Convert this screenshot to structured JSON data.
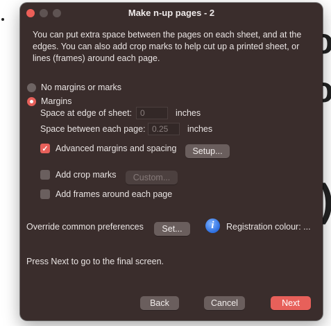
{
  "window": {
    "title": "Make n-up pages - 2"
  },
  "intro": "You can put extra space between the pages on each sheet, and at the edges. You can also add crop marks to help cut up a printed sheet, or lines (frames) around each page.",
  "options": {
    "no_margins_label": "No margins or marks",
    "margins_label": "Margins",
    "selected": "Margins"
  },
  "edge": {
    "label": "Space at edge of sheet:",
    "value": "0",
    "unit": "inches"
  },
  "between": {
    "label": "Space between each page:",
    "value": "0.25",
    "unit": "inches"
  },
  "advanced": {
    "label": "Advanced margins and spacing",
    "checked": true,
    "button": "Setup..."
  },
  "crop": {
    "label": "Add crop marks",
    "checked": false,
    "button": "Custom..."
  },
  "frames": {
    "label": "Add frames around each page",
    "checked": false
  },
  "override": {
    "label": "Override common preferences",
    "button": "Set...",
    "registration_label": "Registration colour: ..."
  },
  "hint": "Press Next to go to the final screen.",
  "footer": {
    "back": "Back",
    "cancel": "Cancel",
    "next": "Next"
  },
  "colors": {
    "accent": "#e7605a",
    "background": "#3a2d2c"
  }
}
